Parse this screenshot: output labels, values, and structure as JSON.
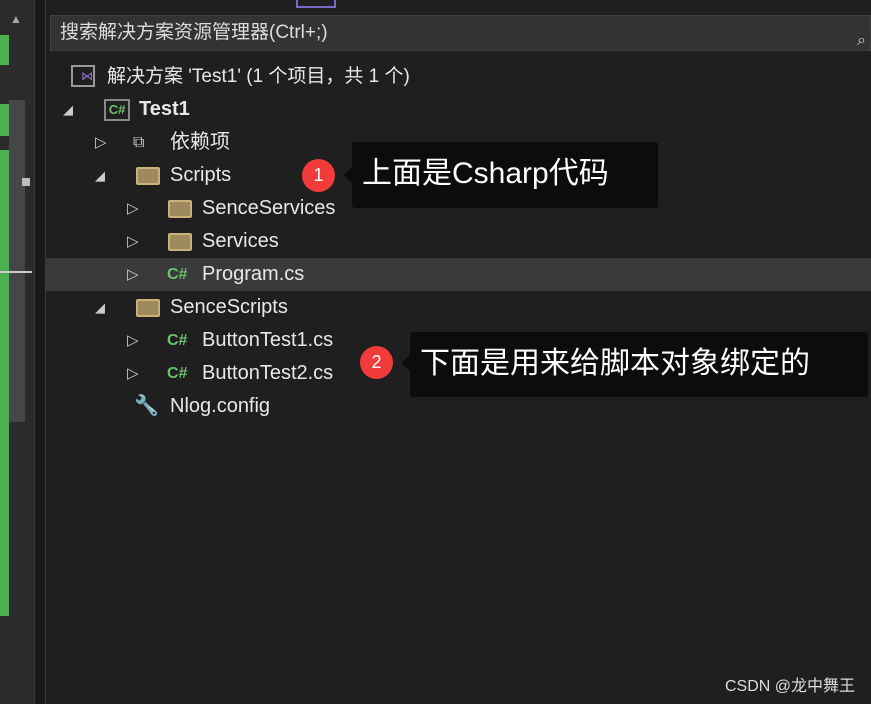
{
  "search": {
    "placeholder": "搜索解决方案资源管理器(Ctrl+;)"
  },
  "tree": {
    "solution": "解决方案 'Test1' (1 个项目，共 1 个)",
    "project": "Test1",
    "items": [
      {
        "label": "依赖项",
        "icon": "dependencies-icon",
        "expanded": false
      },
      {
        "label": "Scripts",
        "icon": "folder-icon",
        "expanded": true
      },
      {
        "label": "SenceServices",
        "icon": "folder-icon",
        "expanded": false
      },
      {
        "label": "Services",
        "icon": "folder-icon",
        "expanded": false
      },
      {
        "label": "Program.cs",
        "icon": "csharp-file-icon",
        "expanded": false,
        "selected": true
      },
      {
        "label": "SenceScripts",
        "icon": "folder-icon",
        "expanded": true
      },
      {
        "label": "ButtonTest1.cs",
        "icon": "csharp-file-icon",
        "expanded": false
      },
      {
        "label": "ButtonTest2.cs",
        "icon": "csharp-file-icon",
        "expanded": false
      },
      {
        "label": "Nlog.config",
        "icon": "config-file-icon"
      }
    ],
    "cs_glyph": "C#"
  },
  "annotations": [
    {
      "number": "1",
      "text": "上面是Csharp代码"
    },
    {
      "number": "2",
      "text": "下面是用来给脚本对象绑定的"
    }
  ],
  "watermark": "CSDN @龙中舞王",
  "colors": {
    "accent_green": "#4caf50",
    "badge": "#f23b3b",
    "csharp": "#6cc26c"
  }
}
